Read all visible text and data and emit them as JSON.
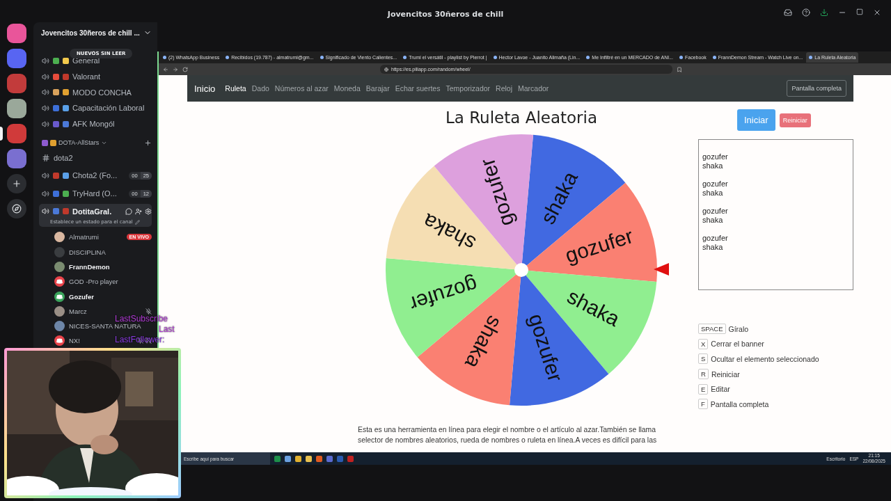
{
  "window": {
    "title": "Jovencitos 30ñeros de chill"
  },
  "server_rail": {
    "servers": [
      {
        "selected": false
      },
      {
        "selected": false
      },
      {
        "selected": false
      },
      {
        "selected": false
      },
      {
        "selected": true
      },
      {
        "selected": false
      }
    ]
  },
  "sidebar": {
    "server_name": "Jovencitos 30ñeros de chill ...",
    "unread_banner": "NUEVOS SIN LEER",
    "voice_channels": [
      {
        "name": "General"
      },
      {
        "name": "Valorant"
      },
      {
        "name": "MODO CONCHA"
      },
      {
        "name": "Capacitación Laboral"
      },
      {
        "name": "AFK Mongól"
      }
    ],
    "category": "DOTA-AllStars",
    "channels": [
      {
        "kind": "text",
        "name": "dota2",
        "selected": false
      },
      {
        "kind": "voice",
        "name": "Chota2 (Fo...",
        "selected": false,
        "counts": [
          "00",
          "25"
        ]
      },
      {
        "kind": "voice",
        "name": "TryHard (O...",
        "selected": false,
        "counts": [
          "00",
          "12"
        ]
      },
      {
        "kind": "voice",
        "name": "DotitaGral.",
        "selected": true,
        "status": "Establece un estado para el canal"
      }
    ],
    "members": [
      {
        "name": "Almatrumi",
        "bold": false,
        "live": "EN VIVO",
        "muted": false,
        "deafened": false
      },
      {
        "name": "DISCIPLINA",
        "bold": false,
        "muted": false,
        "deafened": false
      },
      {
        "name": "FrannDemon",
        "bold": true,
        "muted": false,
        "deafened": false
      },
      {
        "name": "GOD -Pro player",
        "bold": false,
        "avatar": {
          "kind": "discord",
          "color": "#e8434a"
        },
        "muted": false,
        "deafened": false
      },
      {
        "name": "Gozufer",
        "bold": true,
        "avatar": {
          "kind": "discord",
          "color": "#3ba55c"
        },
        "muted": false,
        "deafened": false
      },
      {
        "name": "Marcz",
        "bold": false,
        "muted": true,
        "deafened": false
      },
      {
        "name": "NICES-SANTA NATURA",
        "bold": false,
        "muted": false,
        "deafened": false
      },
      {
        "name": "NX!",
        "bold": false,
        "avatar": {
          "kind": "discord",
          "color": "#e8434a"
        },
        "muted": true,
        "deafened": true
      }
    ]
  },
  "stream_overlay": [
    "LastSubscribe",
    "Last",
    "LastFollower: "
  ],
  "browser": {
    "tabs": [
      {
        "title": "(2) WhatsApp Business",
        "selected": false
      },
      {
        "title": "Recibidos (19.787) - almatrumi@gm...",
        "selected": false
      },
      {
        "title": "Significado de Viento Calientes...",
        "selected": false
      },
      {
        "title": "Trumi el versátil - playlist by Pierrot |",
        "selected": false
      },
      {
        "title": "Hector Lavoe - Juanito Alimaña (Lin...",
        "selected": false
      },
      {
        "title": "Me Infiltré en un MERCADO de ANI...",
        "selected": false
      },
      {
        "title": "Facebook",
        "selected": false
      },
      {
        "title": "FrannDemon Stream - Watch Live on...",
        "selected": false
      },
      {
        "title": "La Ruleta Aleatoria",
        "selected": true
      }
    ],
    "address": "https://es.piliapp.com/random/wheel/",
    "nav": {
      "brand": "Inicio",
      "links": [
        {
          "label": "Ruleta",
          "selected": true
        },
        {
          "label": "Dado",
          "selected": false
        },
        {
          "label": "Números al azar",
          "selected": false
        },
        {
          "label": "Moneda",
          "selected": false
        },
        {
          "label": "Barajar",
          "selected": false
        },
        {
          "label": "Echar suertes",
          "selected": false
        },
        {
          "label": "Temporizador",
          "selected": false
        },
        {
          "label": "Reloj",
          "selected": false
        },
        {
          "label": "Marcador",
          "selected": false
        }
      ],
      "fullscreen_button": "Pantalla completa"
    },
    "title": "La Ruleta Aleatoria",
    "buttons": {
      "start": "Iniciar",
      "reset": "Reiniciar"
    },
    "wheel": {
      "segments": [
        {
          "label": "shaka",
          "color": "#4169e1"
        },
        {
          "label": "gozufer",
          "color": "#fa8072"
        },
        {
          "label": "shaka",
          "color": "#90ee90"
        },
        {
          "label": "gozufer",
          "color": "#4169e1"
        },
        {
          "label": "shaka",
          "color": "#fa8072"
        },
        {
          "label": "gozufer",
          "color": "#90ee90"
        },
        {
          "label": "shaka",
          "color": "#f5deb3"
        },
        {
          "label": "gozufer",
          "color": "#dda0dd"
        }
      ]
    },
    "entries": [
      [
        "gozufer",
        "shaka"
      ],
      [
        "gozufer",
        "shaka"
      ],
      [
        "gozufer",
        "shaka"
      ],
      [
        "gozufer",
        "shaka"
      ]
    ],
    "shortcuts": [
      {
        "key": "SPACE",
        "label": "Gíralo"
      },
      {
        "key": "X",
        "label": "Cerrar el banner"
      },
      {
        "key": "S",
        "label": "Ocultar el elemento seleccionado"
      },
      {
        "key": "R",
        "label": "Reiniciar"
      },
      {
        "key": "E",
        "label": "Editar"
      },
      {
        "key": "F",
        "label": "Pantalla completa"
      }
    ],
    "description": [
      "Esta es una herramienta en línea para elegir el nombre o el artículo al azar.También se llama",
      "selector de nombres aleatorios, rueda de nombres o ruleta en línea.A veces es difícil para las"
    ],
    "taskbar": {
      "search_placeholder": "Escribe aquí para buscar",
      "desktop": "Escritorio",
      "language": "ESP",
      "time": "21:15",
      "date": "22/08/2025"
    }
  }
}
